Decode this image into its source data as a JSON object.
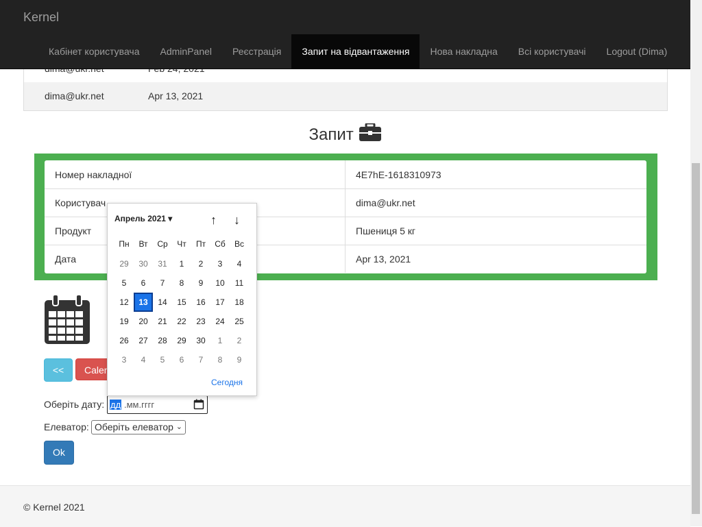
{
  "brand": "Kernel",
  "nav": [
    "Кабінет користувача",
    "AdminPanel",
    "Реєстрація",
    "Запит на відвантаження",
    "Нова накладна",
    "Всі користувачі",
    "Logout (Dima)"
  ],
  "prev_rows": [
    {
      "email": "dima@ukr.net",
      "date": "Feb 24, 2021"
    },
    {
      "email": "dima@ukr.net",
      "date": "Apr 13, 2021"
    }
  ],
  "title": "Запит",
  "info": [
    {
      "key": "Номер накладної",
      "value": "4E7hE-1618310973"
    },
    {
      "key": "Користувач",
      "value": "dima@ukr.net"
    },
    {
      "key": "Продукт",
      "value": "Пшениця 5 кг"
    },
    {
      "key": "Дата",
      "value": "Apr 13, 2021"
    }
  ],
  "buttons": {
    "back": "<<",
    "calendar": "Calendar",
    "ok": "Ok"
  },
  "form": {
    "date_label": "Оберіть дату:",
    "date_dd": "дд",
    "date_rest": ".мм.гггг",
    "elevator_label": "Елеватор:",
    "elevator_selected": "Оберіть елеватор"
  },
  "footer": "© Kernel 2021",
  "picker": {
    "month": "Апрель 2021",
    "dow": [
      "Пн",
      "Вт",
      "Ср",
      "Чт",
      "Пт",
      "Сб",
      "Вс"
    ],
    "weeks": [
      [
        "29",
        "30",
        "31",
        "1",
        "2",
        "3",
        "4"
      ],
      [
        "5",
        "6",
        "7",
        "8",
        "9",
        "10",
        "11"
      ],
      [
        "12",
        "13",
        "14",
        "15",
        "16",
        "17",
        "18"
      ],
      [
        "19",
        "20",
        "21",
        "22",
        "23",
        "24",
        "25"
      ],
      [
        "26",
        "27",
        "28",
        "29",
        "30",
        "1",
        "2"
      ],
      [
        "3",
        "4",
        "5",
        "6",
        "7",
        "8",
        "9"
      ]
    ],
    "selected": "13",
    "today_label": "Сегодня"
  },
  "colors": {
    "navbar": "#222222",
    "green": "#4caf50",
    "primary": "#337ab7",
    "danger": "#d9534f",
    "info": "#5bc0de"
  }
}
